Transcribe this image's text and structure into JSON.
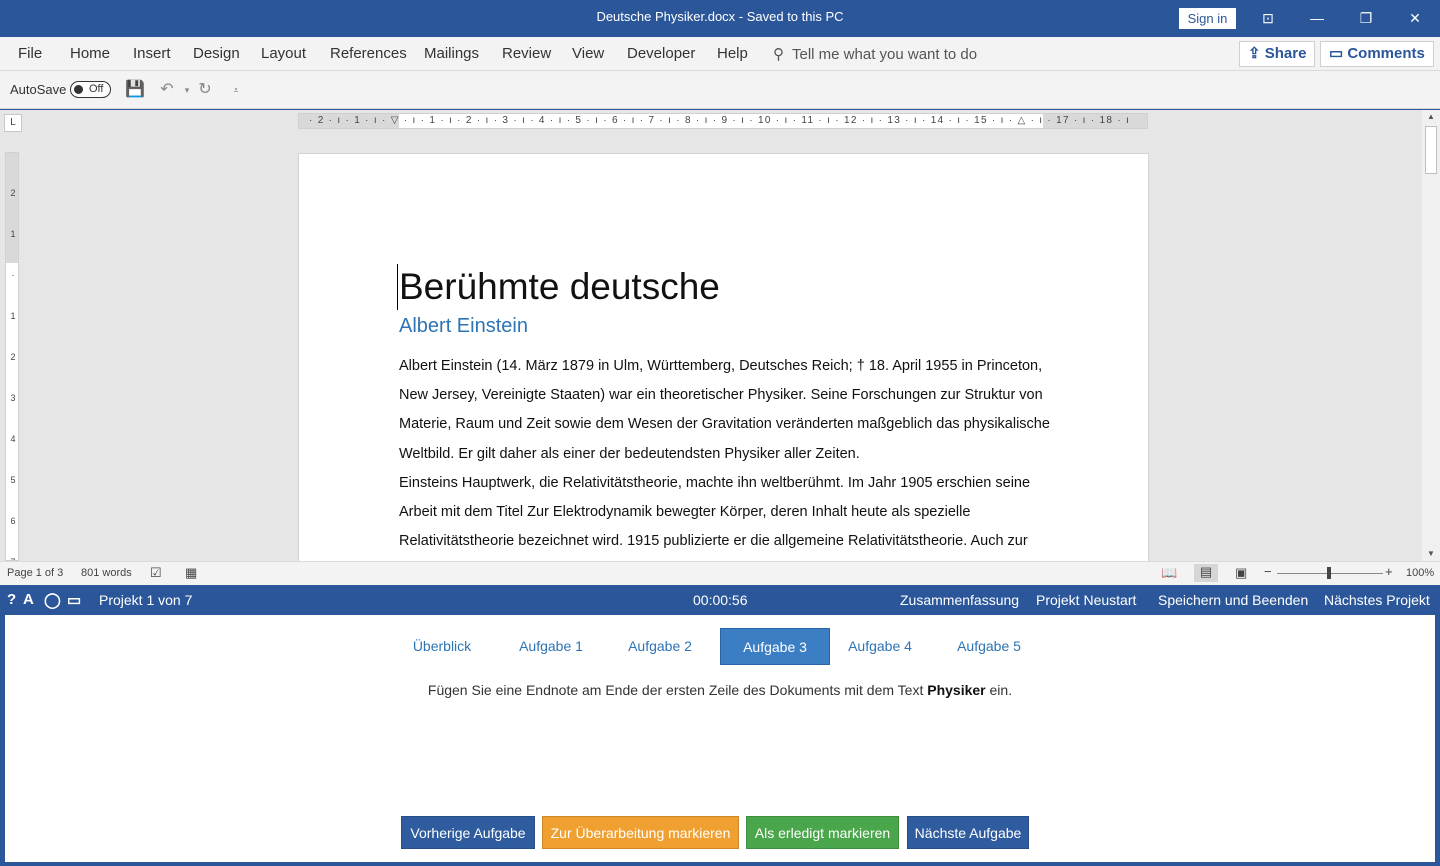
{
  "titlebar": {
    "title": "Deutsche Physiker.docx  -  Saved to this PC",
    "signin": "Sign in"
  },
  "menu": {
    "items": [
      "File",
      "Home",
      "Insert",
      "Design",
      "Layout",
      "References",
      "Mailings",
      "Review",
      "View",
      "Developer",
      "Help"
    ],
    "tellme": "Tell me what you want to do",
    "share": "Share",
    "comments": "Comments"
  },
  "qat": {
    "autosave": "AutoSave",
    "toggle": "Off"
  },
  "ruler": {
    "h_ticks": "· 2 · ı · 1 · ı · ▽ · ı · 1 · ı · 2 · ı · 3 · ı · 4 · ı · 5 · ı · 6 · ı · 7 · ı · 8 · ı · 9 · ı · 10 · ı · 11 · ı · 12 · ı · 13 · ı · 14 · ı · 15 · ı · △ · ı · 17 · ı · 18 · ı"
  },
  "document": {
    "title": "Berühmte deutsche",
    "heading1": "Albert Einstein",
    "paragraph1": "Albert Einstein (14. März 1879 in Ulm, Württemberg, Deutsches Reich; † 18. April 1955 in Princeton, New Jersey, Vereinigte Staaten) war ein theoretischer Physiker. Seine Forschungen zur Struktur von Materie, Raum und Zeit sowie dem Wesen der Gravitation veränderten maßgeblich das physikalische Weltbild. Er gilt daher als einer der bedeutendsten Physiker aller Zeiten.",
    "paragraph2": "Einsteins Hauptwerk, die Relativitätstheorie, machte ihn weltberühmt. Im Jahr 1905 erschien seine Arbeit mit dem Titel Zur Elektrodynamik bewegter Körper, deren Inhalt heute als spezielle Relativitätstheorie bezeichnet wird. 1915 publizierte er die allgemeine Relativitätstheorie. Auch zur"
  },
  "status": {
    "page": "Page 1 of 3",
    "words": "801 words",
    "zoom": "100%"
  },
  "project": {
    "label": "Projekt 1 von 7",
    "timer": "00:00:56",
    "actions": [
      "Zusammenfassung",
      "Projekt Neustart",
      "Speichern und Beenden",
      "Nächstes Projekt"
    ]
  },
  "tasks": {
    "tabs": [
      "Überblick",
      "Aufgabe 1",
      "Aufgabe 2",
      "Aufgabe 3",
      "Aufgabe 4",
      "Aufgabe 5"
    ],
    "active_tab": "Aufgabe 3",
    "instruction_pre": "Fügen Sie eine Endnote am Ende der ersten Zeile des Dokuments mit dem Text ",
    "instruction_bold": "Physiker",
    "instruction_post": " ein.",
    "buttons": {
      "prev": "Vorherige Aufgabe",
      "review": "Zur Überarbeitung markieren",
      "done": "Als erledigt markieren",
      "next": "Nächste Aufgabe"
    }
  },
  "colors": {
    "brand": "#2b579a",
    "heading": "#2e74b5",
    "review": "#f0a030",
    "done": "#4aa64a"
  }
}
